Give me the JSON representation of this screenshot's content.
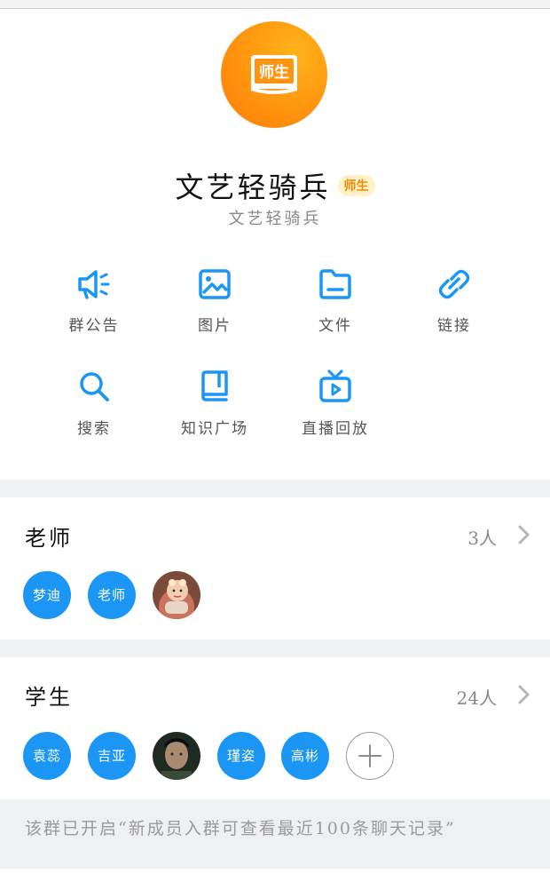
{
  "group": {
    "avatar_text": "师生",
    "name": "文艺轻骑兵",
    "badge": "师生",
    "subtitle": "文艺轻骑兵"
  },
  "functions": [
    {
      "label": "群公告",
      "icon": "megaphone-icon"
    },
    {
      "label": "图片",
      "icon": "image-icon"
    },
    {
      "label": "文件",
      "icon": "folder-icon"
    },
    {
      "label": "链接",
      "icon": "link-icon"
    },
    {
      "label": "搜索",
      "icon": "search-icon"
    },
    {
      "label": "知识广场",
      "icon": "book-icon"
    },
    {
      "label": "直播回放",
      "icon": "tv-icon"
    }
  ],
  "teachers": {
    "title": "老师",
    "count": "3人",
    "members": [
      {
        "text": "梦迪",
        "color": "#1c96f4"
      },
      {
        "text": "老师",
        "color": "#1c96f4"
      },
      {
        "text": "",
        "type": "photo"
      }
    ]
  },
  "students": {
    "title": "学生",
    "count": "24人",
    "members": [
      {
        "text": "袁蕊",
        "color": "#1c96f4"
      },
      {
        "text": "吉亚",
        "color": "#1c96f4"
      },
      {
        "text": "",
        "type": "photo"
      },
      {
        "text": "瑾姿",
        "color": "#1c96f4"
      },
      {
        "text": "高彬",
        "color": "#1c96f4"
      }
    ]
  },
  "notice": "该群已开启“新成员入群可查看最近100条聊天记录”",
  "colors": {
    "accent": "#1c96f4",
    "avatar_orange": "#ff8c0a",
    "badge_text": "#f18a00"
  }
}
